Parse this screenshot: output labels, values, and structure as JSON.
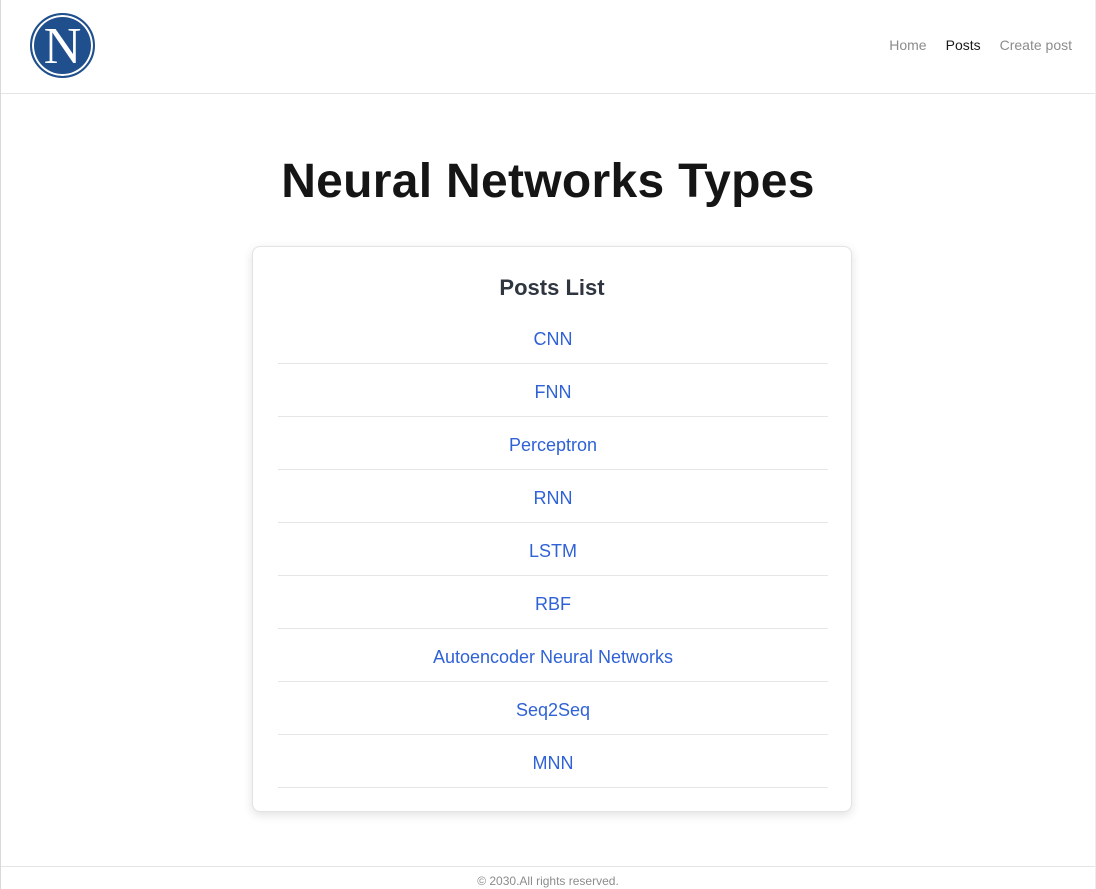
{
  "header": {
    "logo_letter": "N",
    "nav": [
      {
        "label": "Home"
      },
      {
        "label": "Posts"
      },
      {
        "label": "Create post"
      }
    ]
  },
  "main": {
    "title": "Neural Networks Types",
    "card": {
      "title": "Posts List",
      "posts": [
        {
          "label": "CNN"
        },
        {
          "label": "FNN"
        },
        {
          "label": "Perceptron"
        },
        {
          "label": "RNN"
        },
        {
          "label": "LSTM"
        },
        {
          "label": "RBF"
        },
        {
          "label": "Autoencoder Neural Networks"
        },
        {
          "label": "Seq2Seq"
        },
        {
          "label": "MNN"
        }
      ]
    }
  },
  "footer": {
    "text": "© 2030.All rights reserved."
  },
  "colors": {
    "logo_bg": "#1f4f8c",
    "link": "#2f62d6",
    "nav_muted": "#8c8c8c",
    "nav_active": "#1a1a1a"
  }
}
